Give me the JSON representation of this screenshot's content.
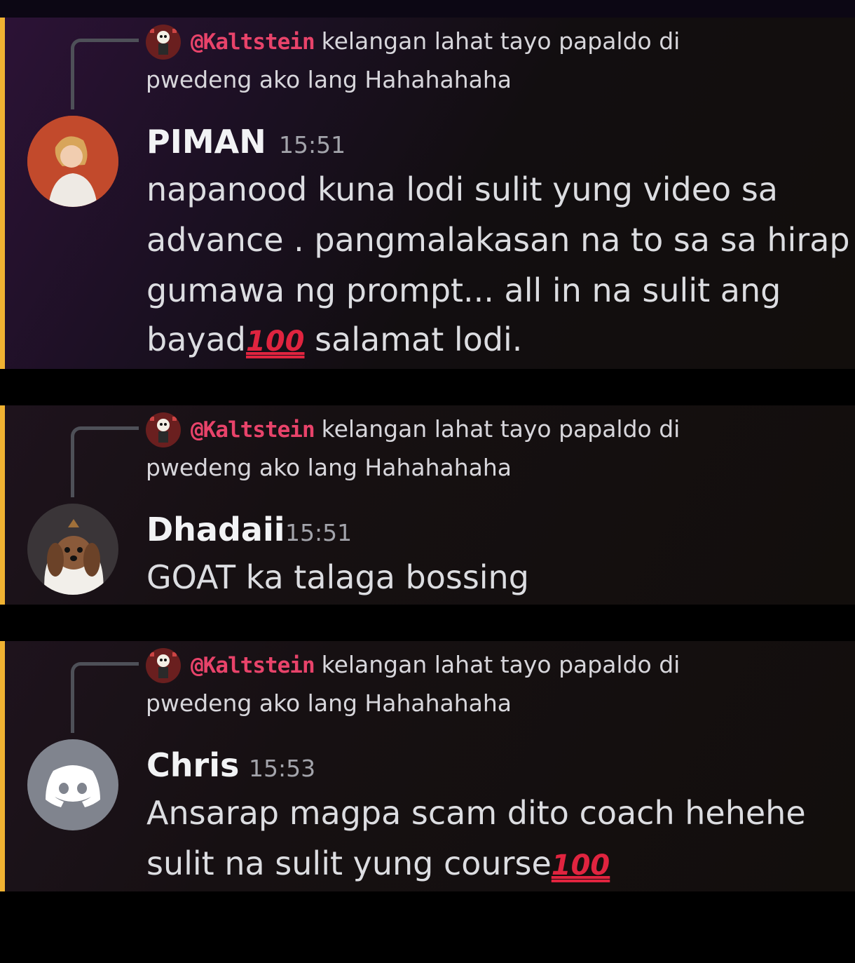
{
  "reply_reference": {
    "mention": "@Kaltstein",
    "line1": "kelangan lahat tayo papaldo di",
    "line2": "pwedeng ako lang Hahahahaha"
  },
  "messages": [
    {
      "author": "PIMAN",
      "time": "15:51",
      "lines": [
        "napanood kuna lodi sulit yung video sa",
        "advance . pangmalakasan na to sa sa hirap",
        "gumawa ng prompt... all in na sulit ang"
      ],
      "last_before": "bayad",
      "last_emoji": "💯",
      "last_after": " salamat lodi.",
      "avatar": "girl-portrait-avatar"
    },
    {
      "author": "Dhadaii",
      "time": "15:51",
      "lines": [
        "GOAT ka talaga bossing"
      ],
      "avatar": "dog-avatar"
    },
    {
      "author": "Chris",
      "time": "15:53",
      "lines": [
        "Ansarap magpa scam dito coach hehehe"
      ],
      "last_before": "sulit na sulit yung course",
      "last_emoji": "💯",
      "last_after": "",
      "avatar": "discord-default-avatar"
    }
  ],
  "emoji_text": "100",
  "colors": {
    "accent": "#f0b232",
    "mention": "#e8436a",
    "emoji": "#e0243f"
  }
}
